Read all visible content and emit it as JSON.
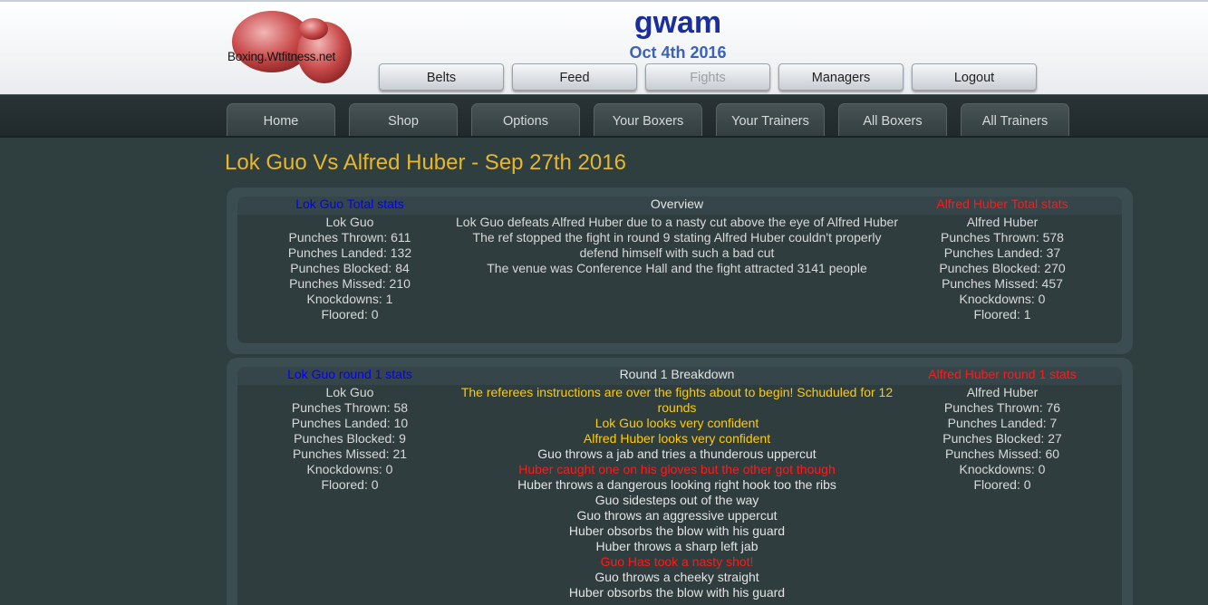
{
  "header": {
    "logo_text": "Boxing.Wtfitness.net",
    "site_name": "gwam",
    "date": "Oct 4th 2016",
    "nav": [
      "Belts",
      "Feed",
      "Fights",
      "Managers",
      "Logout"
    ]
  },
  "subnav": [
    "Home",
    "Shop",
    "Options",
    "Your Boxers",
    "Your Trainers",
    "All Boxers",
    "All Trainers"
  ],
  "page_title": "Lok Guo Vs Alfred Huber - Sep 27th 2016",
  "overview": {
    "left_heading": "Lok Guo Total stats",
    "mid_heading": "Overview",
    "right_heading": "Alfred Huber Total stats",
    "left_stats": [
      "Lok Guo",
      "Punches Thrown: 611",
      "Punches Landed: 132",
      "Punches Blocked: 84",
      "Punches Missed: 210",
      "Knockdowns: 1",
      "Floored: 0"
    ],
    "summary": [
      "Lok Guo defeats Alfred Huber due to a nasty cut above the eye of Alfred Huber",
      "The ref stopped the fight in round 9 stating Alfred Huber couldn't properly defend himself with such a bad cut",
      "The venue was Conference Hall and the fight attracted 3141 people"
    ],
    "right_stats": [
      "Alfred Huber",
      "Punches Thrown: 578",
      "Punches Landed: 37",
      "Punches Blocked: 270",
      "Punches Missed: 457",
      "Knockdowns: 0",
      "Floored: 1"
    ]
  },
  "round1": {
    "left_heading": "Lok Guo round 1 stats",
    "mid_heading": "Round 1 Breakdown",
    "right_heading": "Alfred Huber round 1 stats",
    "left_stats": [
      "Lok Guo",
      "Punches Thrown: 58",
      "Punches Landed: 10",
      "Punches Blocked: 9",
      "Punches Missed: 21",
      "Knockdowns: 0",
      "Floored: 0"
    ],
    "events": [
      "The referees instructions are over the fights about to begin! Schuduled for 12 rounds",
      "Lok Guo looks very confident",
      "Alfred Huber looks very confident",
      "Guo throws a jab and tries a thunderous uppercut",
      "Huber caught one on his gloves but the other got though",
      "Huber throws a dangerous looking right hook too the ribs",
      "Guo sidesteps out of the way",
      "Guo throws an aggressive uppercut",
      "Huber obsorbs the blow with his guard",
      "Huber throws a sharp left jab",
      "Guo Has took a nasty shot!",
      "Guo throws a cheeky straight",
      "Huber obsorbs the blow with his guard"
    ],
    "right_stats": [
      "Alfred Huber",
      "Punches Thrown: 76",
      "Punches Landed: 7",
      "Punches Blocked: 27",
      "Punches Missed: 60",
      "Knockdowns: 0",
      "Floored: 0"
    ]
  },
  "colors": {
    "event_yellow": "#ffcc00",
    "event_red": "#ff1a1a",
    "event_white": "#e4e4e4",
    "left_link": "#0000ff",
    "right_link": "#ff1a1a",
    "title": "#e8b62c"
  }
}
